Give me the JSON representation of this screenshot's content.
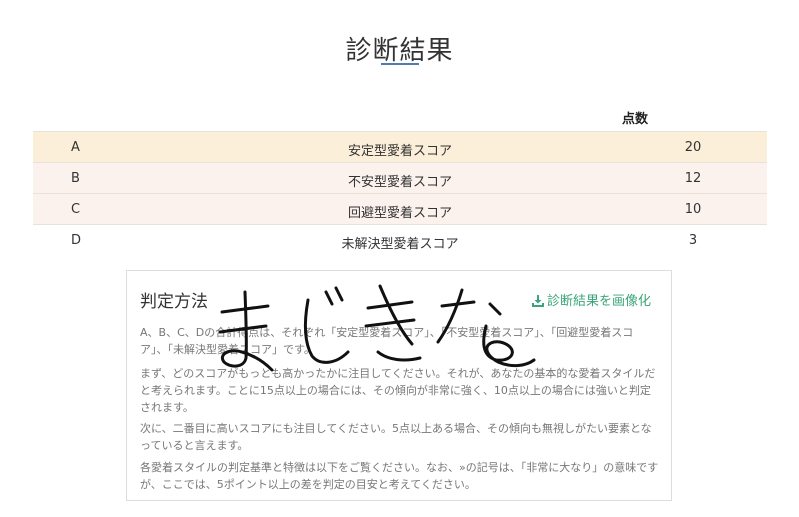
{
  "page": {
    "title": "診断結果"
  },
  "table": {
    "score_header": "点数",
    "rows": [
      {
        "letter": "A",
        "name": "安定型愛着スコア",
        "score": "20"
      },
      {
        "letter": "B",
        "name": "不安型愛着スコア",
        "score": "12"
      },
      {
        "letter": "C",
        "name": "回避型愛着スコア",
        "score": "10"
      },
      {
        "letter": "D",
        "name": "未解決型愛着スコア",
        "score": "3"
      }
    ]
  },
  "method": {
    "title": "判定方法",
    "image_button": "診断結果を画像化",
    "paragraphs": [
      "A、B、C、Dの合計得点は、それぞれ「安定型愛着スコア」、「不安型愛着スコア」、「回避型愛着スコア」、「未解決型愛着スコア」です。",
      "まず、どのスコアがもっとも高かったかに注目してください。それが、あなたの基本的な愛着スタイルだと考えられます。ことに15点以上の場合には、その傾向が非常に強く、10点以上の場合には強いと判定されます。",
      "次に、二番目に高いスコアにも注目してください。5点以上ある場合、その傾向も無視しがたい要素となっていると言えます。",
      "各愛着スタイルの判定基準と特徴は以下をご覧ください。なお、»の記号は、「非常に大なり」の意味ですが、ここでは、5ポイント以上の差を判定の目安と考えてください。"
    ]
  },
  "handwriting": {
    "text": "まじきな"
  },
  "colors": {
    "accent": "#3aa57a",
    "row_a": "#fcefd9",
    "row_bc": "#fbf2ee",
    "underline": "#4a7fb0"
  },
  "icons": {
    "image_button": "download-icon"
  }
}
